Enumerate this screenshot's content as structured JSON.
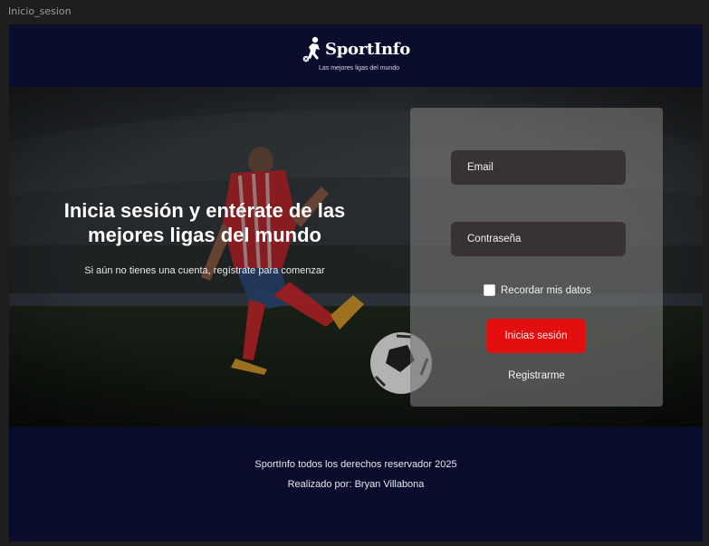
{
  "frame": {
    "label": "Inicio_sesion"
  },
  "header": {
    "brand": "SportInfo",
    "tagline": "Las mejores ligas del mundo"
  },
  "hero": {
    "title": "Inicia sesión y entérate de las mejores ligas del mundo",
    "subtitle": "Si aún no tienes una cuenta, regístrate para comenzar"
  },
  "login": {
    "email_placeholder": "Email",
    "password_placeholder": "Contraseña",
    "remember_label": "Recordar mis datos",
    "submit_label": "Inicias sesión",
    "register_label": "Registrarme"
  },
  "footer": {
    "copyright": "SportInfo todos los derechos reservador 2025",
    "credits": "Realizado por: Bryan Villabona"
  },
  "colors": {
    "navy": "#0a0d2c",
    "accent_red": "#e30f0f",
    "input_bg": "#383232",
    "card_bg": "rgba(120,120,120,0.62)"
  }
}
